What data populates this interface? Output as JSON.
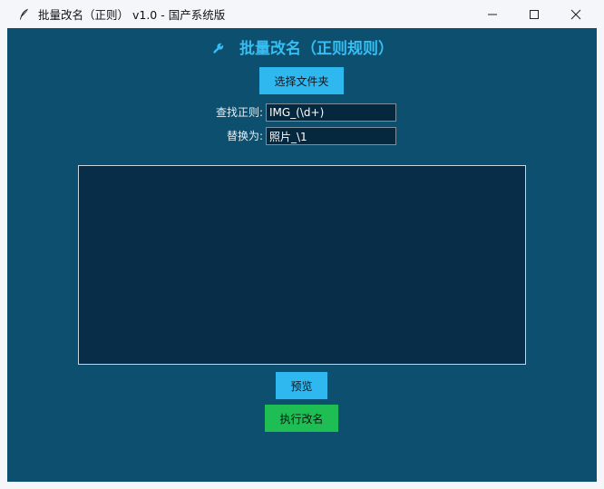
{
  "window": {
    "title": "批量改名（正则） v1.0 - 国产系统版",
    "icon": "feather-icon",
    "controls": [
      "minimize-icon",
      "maximize-icon",
      "close-icon"
    ]
  },
  "main": {
    "heading": "批量改名（正则规则）",
    "heading_icon": "wrench-icon",
    "select_folder_label": "选择文件夹",
    "find_label": "查找正则:",
    "find_value": "IMG_(\\d+)",
    "replace_label": "替换为:",
    "replace_value": "照片_\\1",
    "preview_label": "预览",
    "run_label": "执行改名"
  },
  "colors": {
    "background": "#0c4f6e",
    "accent": "#36bdf2",
    "button_blue": "#2fb8f0",
    "button_green": "#1fbe55",
    "input_bg": "#06283f",
    "list_bg": "#072d48"
  }
}
